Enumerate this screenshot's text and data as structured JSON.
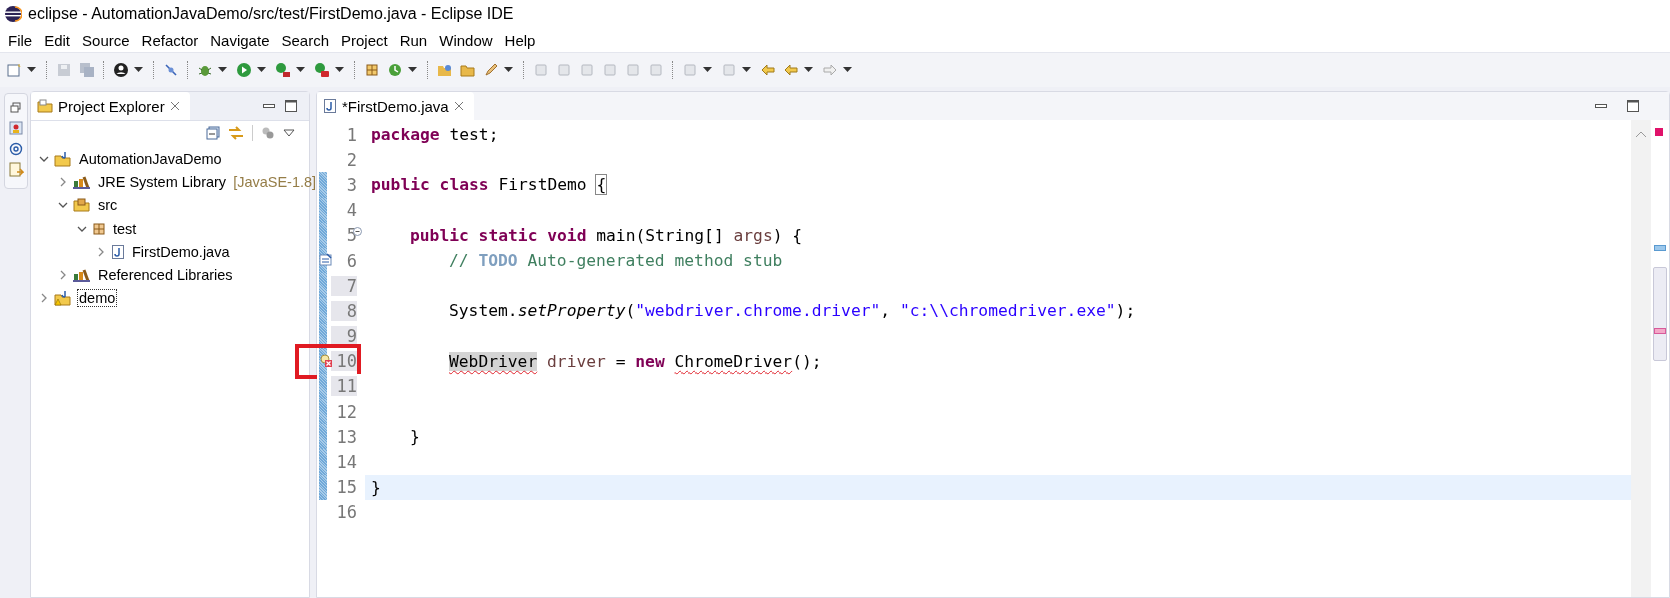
{
  "window": {
    "title": "eclipse - AutomationJavaDemo/src/test/FirstDemo.java - Eclipse IDE"
  },
  "menu": [
    "File",
    "Edit",
    "Source",
    "Refactor",
    "Navigate",
    "Search",
    "Project",
    "Run",
    "Window",
    "Help"
  ],
  "explorer": {
    "title": "Project Explorer",
    "selected": true,
    "tree": [
      {
        "label": "AutomationJavaDemo",
        "kind": "project",
        "expanded": true,
        "focused": false,
        "children": [
          {
            "label": "JRE System Library",
            "decoration": "[JavaSE-1.8]",
            "kind": "library",
            "expanded": false,
            "focused": false
          },
          {
            "label": "src",
            "kind": "source-folder",
            "expanded": true,
            "focused": false,
            "children": [
              {
                "label": "test",
                "kind": "package",
                "expanded": true,
                "focused": false,
                "children": [
                  {
                    "label": "FirstDemo.java",
                    "kind": "java-file",
                    "expanded": false,
                    "focused": false
                  }
                ]
              }
            ]
          },
          {
            "label": "Referenced Libraries",
            "kind": "library",
            "expanded": false,
            "focused": false
          }
        ]
      },
      {
        "label": "demo",
        "kind": "project-warning",
        "expanded": false,
        "focused": true
      }
    ]
  },
  "editor": {
    "tab": {
      "label": "*FirstDemo.java",
      "selected": true
    },
    "lines": [
      {
        "number": "1",
        "changed": false,
        "shaded": false,
        "current": false,
        "boxed": false,
        "tokens": [
          {
            "text": "package",
            "kind": "kw"
          },
          {
            "text": " test;",
            "kind": "plain"
          }
        ]
      },
      {
        "number": "2",
        "changed": false,
        "shaded": false,
        "current": false,
        "boxed": false
      },
      {
        "number": "3",
        "changed": true,
        "shaded": false,
        "current": false,
        "boxed": false,
        "tokens": [
          {
            "text": "public class",
            "kind": "kw"
          },
          {
            "text": " FirstDemo ",
            "kind": "plain"
          },
          {
            "text": "{",
            "kind": "plain",
            "matched": true
          }
        ],
        "children": [
          {
            "number": "4",
            "changed": true,
            "shaded": false,
            "current": false,
            "boxed": false
          },
          {
            "number": "5",
            "kind": "fold",
            "changed": true,
            "shaded": false,
            "current": false,
            "boxed": false,
            "tokens": [
              {
                "text": "public static void",
                "kind": "kw"
              },
              {
                "text": " main(String[] ",
                "kind": "plain"
              },
              {
                "text": "args",
                "kind": "var"
              },
              {
                "text": ") {",
                "kind": "plain"
              }
            ],
            "children": [
              {
                "number": "6",
                "kind": "task",
                "changed": true,
                "shaded": false,
                "current": false,
                "boxed": false,
                "tokens": [
                  {
                    "text": "// ",
                    "kind": "comment"
                  },
                  {
                    "text": "TODO",
                    "kind": "task"
                  },
                  {
                    "text": " Auto-generated method stub",
                    "kind": "comment"
                  }
                ]
              },
              {
                "number": "7",
                "changed": true,
                "shaded": true,
                "current": false,
                "boxed": false
              },
              {
                "number": "8",
                "changed": true,
                "shaded": true,
                "current": false,
                "boxed": false,
                "tokens": [
                  {
                    "text": "System.",
                    "kind": "plain"
                  },
                  {
                    "text": "setProperty",
                    "kind": "static"
                  },
                  {
                    "text": "(",
                    "kind": "plain"
                  },
                  {
                    "text": "\"webdriver.chrome.driver\"",
                    "kind": "str"
                  },
                  {
                    "text": ", ",
                    "kind": "plain"
                  },
                  {
                    "text": "\"c:\\\\chromedriver.exe\"",
                    "kind": "str"
                  },
                  {
                    "text": ");",
                    "kind": "plain"
                  }
                ]
              },
              {
                "number": "9",
                "changed": true,
                "shaded": true,
                "current": false,
                "boxed": false
              },
              {
                "number": "10",
                "kind": "error",
                "changed": true,
                "shaded": true,
                "current": false,
                "boxed": true,
                "tokens": [
                  {
                    "text": "WebDriver",
                    "kind": "plain",
                    "error": true,
                    "occurrence": true
                  },
                  {
                    "text": " driver",
                    "kind": "var"
                  },
                  {
                    "text": " = ",
                    "kind": "plain"
                  },
                  {
                    "text": "new ",
                    "kind": "kw"
                  },
                  {
                    "text": "ChromeDriver",
                    "kind": "plain",
                    "error": true
                  },
                  {
                    "text": "();",
                    "kind": "plain"
                  }
                ]
              },
              {
                "number": "11",
                "changed": true,
                "shaded": true,
                "current": false,
                "boxed": false
              },
              {
                "number": "12",
                "changed": true,
                "shaded": false,
                "current": false,
                "boxed": false
              }
            ]
          },
          {
            "number": "13",
            "changed": true,
            "shaded": false,
            "current": false,
            "boxed": false,
            "tokens": [
              {
                "text": "}",
                "kind": "plain"
              }
            ]
          },
          {
            "number": "14",
            "changed": true,
            "shaded": false,
            "current": false,
            "boxed": false
          }
        ]
      },
      {
        "number": "15",
        "changed": true,
        "shaded": false,
        "current": true,
        "boxed": false,
        "tokens": [
          {
            "text": "}",
            "kind": "plain"
          }
        ]
      },
      {
        "number": "16",
        "changed": false,
        "shaded": false,
        "current": false,
        "boxed": false
      }
    ]
  }
}
